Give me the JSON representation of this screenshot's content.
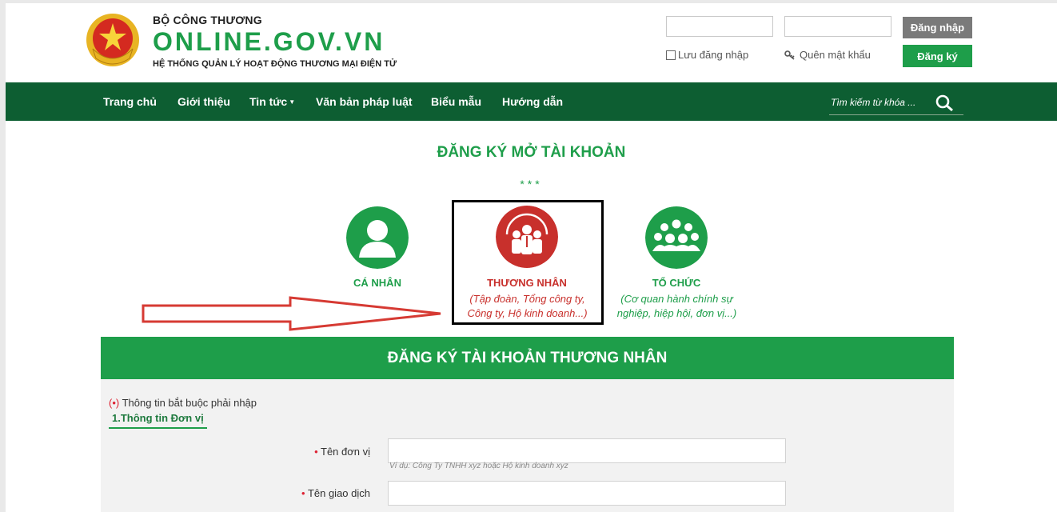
{
  "header": {
    "ministry": "BỘ CÔNG THƯƠNG",
    "site": "ONLINE.GOV.VN",
    "subtitle": "HỆ THỐNG QUẢN LÝ HOẠT ĐỘNG THƯƠNG MẠI ĐIỆN TỬ",
    "login_button": "Đăng nhập",
    "register_button": "Đăng ký",
    "remember_label": "Lưu đăng nhập",
    "forgot_label": "Quên mật khẩu",
    "username_value": "",
    "password_value": ""
  },
  "nav": {
    "items": [
      "Trang chủ",
      "Giới thiệu",
      "Tin tức",
      "Văn bản pháp luật",
      "Biểu mẫu",
      "Hướng dẫn"
    ],
    "search_placeholder": "Tìm kiếm từ khóa ..."
  },
  "page": {
    "title": "ĐĂNG KÝ MỞ TÀI KHOẢN",
    "stars": "***"
  },
  "account_types": [
    {
      "label": "CÁ NHÂN",
      "desc": "",
      "color": "#1e9e4a",
      "icon": "person-icon"
    },
    {
      "label": "THƯƠNG NHÂN",
      "desc": "(Tập đoàn, Tổng công ty, Công ty, Hộ kinh doanh...)",
      "color": "#c8302c",
      "icon": "business-group-icon"
    },
    {
      "label": "TỔ CHỨC",
      "desc": "(Cơ quan hành chính sự nghiệp, hiệp hội, đơn vị...)",
      "color": "#1e9e4a",
      "icon": "organization-icon"
    }
  ],
  "form": {
    "heading": "ĐĂNG KÝ TÀI KHOẢN THƯƠNG NHÂN",
    "required_marker": "(•)",
    "required_note": "Thông tin bắt buộc phải nhập",
    "section_title": "1.Thông tin Đơn vị",
    "fields": [
      {
        "label": "Tên đơn vị",
        "value": "",
        "hint": "Ví dụ: Công Ty TNHH xyz hoặc Hộ kinh doanh xyz"
      },
      {
        "label": "Tên giao dịch",
        "value": ""
      }
    ]
  },
  "colors": {
    "primary": "#1e9e4a",
    "nav": "#0d5e32",
    "accent_red": "#c8302c"
  }
}
